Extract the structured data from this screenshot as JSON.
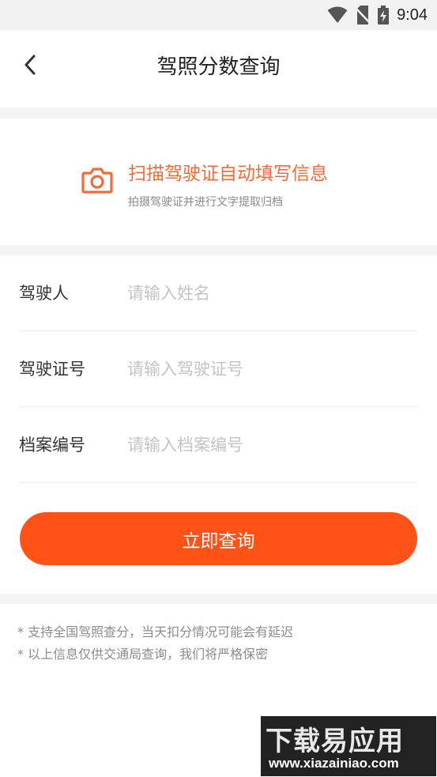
{
  "status_bar": {
    "time": "9:04"
  },
  "header": {
    "title": "驾照分数查询",
    "back_icon": "chevron-left-icon"
  },
  "scan": {
    "title": "扫描驾驶证自动填写信息",
    "subtitle": "拍摄驾驶证并进行文字提取归档",
    "icon": "camera-icon",
    "accent_color": "#f26b3a"
  },
  "form": {
    "fields": [
      {
        "label": "驾驶人",
        "placeholder": "请输入姓名",
        "value": ""
      },
      {
        "label": "驾驶证号",
        "placeholder": "请输入驾驶证号",
        "value": ""
      },
      {
        "label": "档案编号",
        "placeholder": "请输入档案编号",
        "value": ""
      }
    ],
    "submit_label": "立即查询",
    "button_color": "#ff5216"
  },
  "notes": [
    "* 支持全国驾照查分，当天扣分情况可能会有延迟",
    "* 以上信息仅供交通局查询，我们将严格保密"
  ],
  "watermark": {
    "title": "下载易应用",
    "url": "www.xiazainiao.com"
  }
}
